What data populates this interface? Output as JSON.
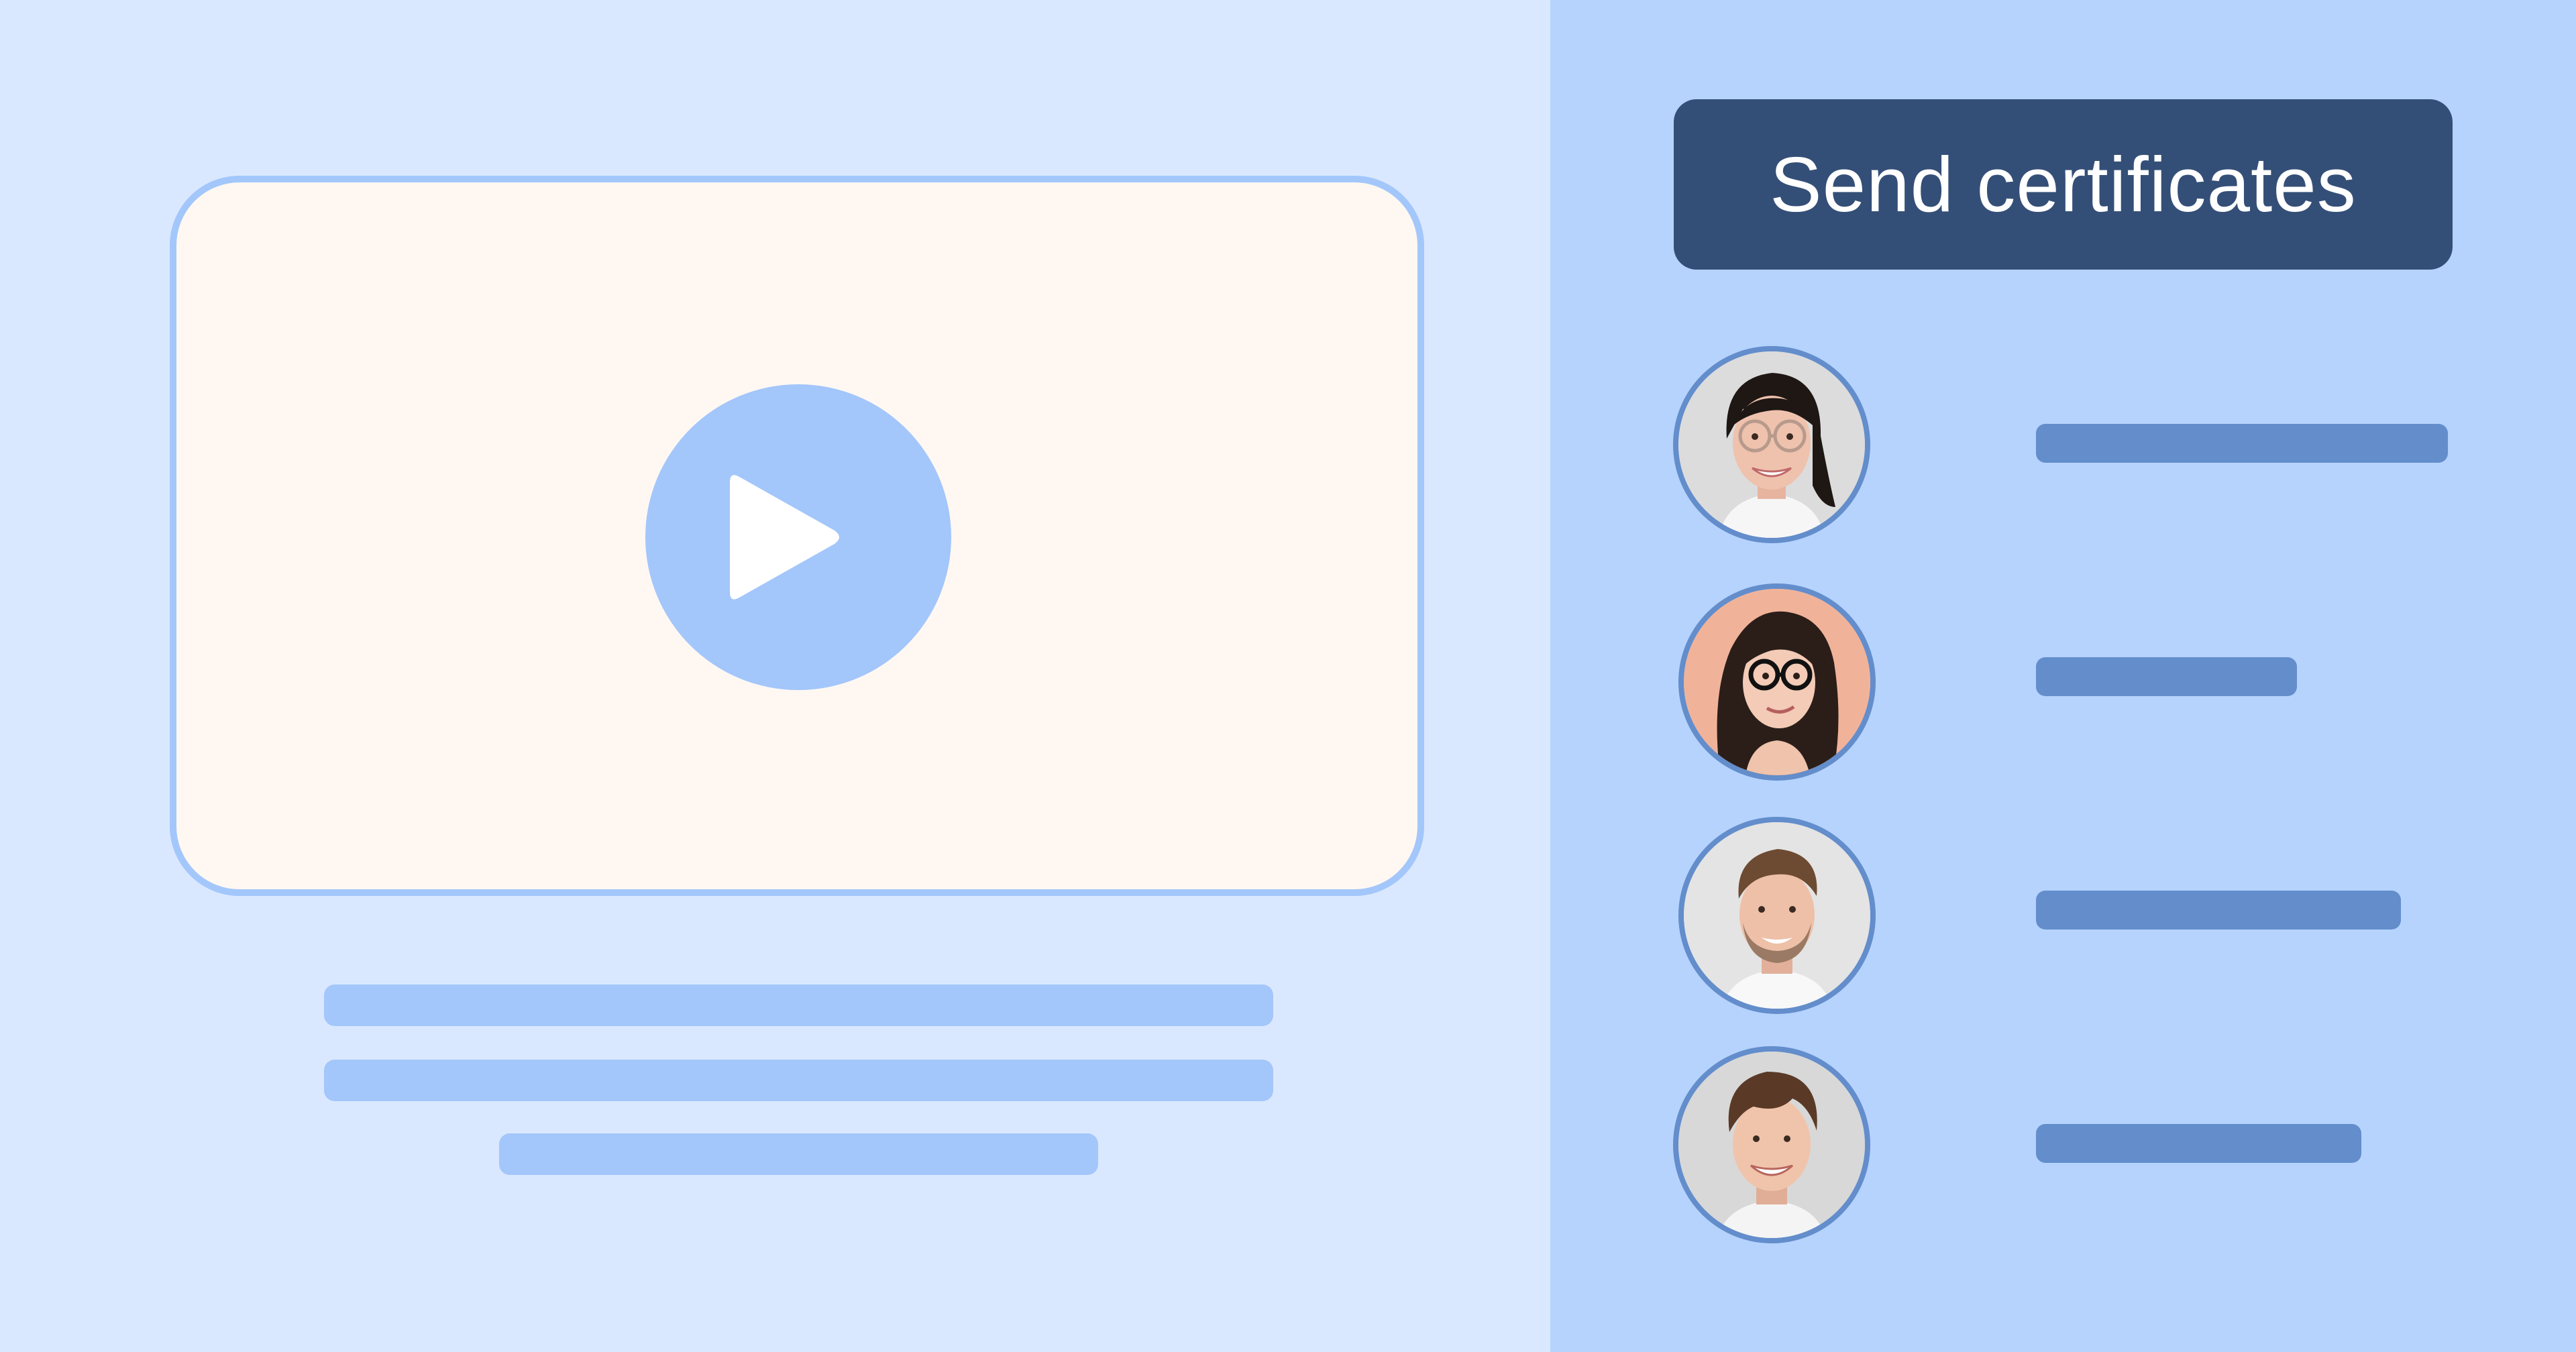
{
  "send_button": {
    "label": "Send certificates"
  },
  "colors": {
    "left_background": "#dae8ff",
    "right_background": "#b5d3fd",
    "video_background": "#fff8f2",
    "accent": "#a3c6fb",
    "button_background": "#344f77",
    "name_bar": "#638dcb"
  },
  "icons": {
    "play": "play-icon"
  },
  "recipients": [
    {
      "avatar": "woman-with-glasses-avatar"
    },
    {
      "avatar": "woman-with-dark-glasses-avatar"
    },
    {
      "avatar": "man-with-beard-avatar"
    },
    {
      "avatar": "young-man-avatar"
    }
  ]
}
